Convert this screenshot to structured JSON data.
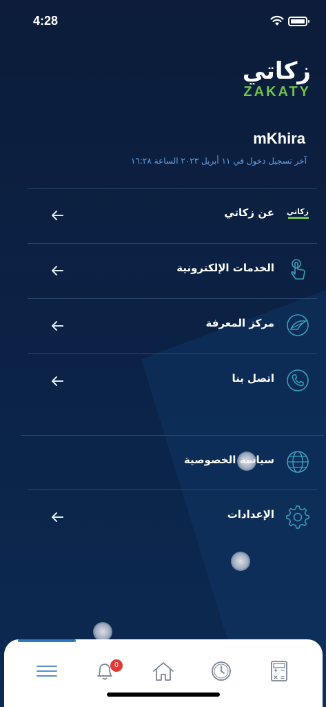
{
  "status_bar": {
    "time": "4:28"
  },
  "logo": {
    "arabic": "زكاتي",
    "english": "ZAKATY"
  },
  "user": {
    "name": "mKhira",
    "last_login": "آخر تسجيل دخول في ١١ أبريل ٢٠٢٣ الساعة ١٦:٢٨"
  },
  "menu": {
    "items": [
      {
        "label": "عن زكاتي",
        "icon": "zakaty-logo-icon"
      },
      {
        "label": "الخدمات الإلكترونية",
        "icon": "touch-hand-icon"
      },
      {
        "label": "مركز المعرفة",
        "icon": "knowledge-leaf-icon"
      },
      {
        "label": "اتصل بنا",
        "icon": "phone-icon"
      },
      {
        "label": "سياسة الخصوصية",
        "icon": "globe-icon"
      },
      {
        "label": "الإعدادات",
        "icon": "gear-icon"
      }
    ]
  },
  "bottom_nav": {
    "tabs": [
      {
        "icon": "menu-icon",
        "active": true
      },
      {
        "icon": "bell-icon",
        "badge": "0"
      },
      {
        "icon": "home-icon"
      },
      {
        "icon": "clock-icon"
      },
      {
        "icon": "calculator-icon"
      }
    ]
  },
  "colors": {
    "background": "#0c1c3a",
    "accent_green": "#6fc24a",
    "accent_teal": "#3aa0b8",
    "link_blue": "#5fa3e6",
    "badge_red": "#e53935"
  }
}
